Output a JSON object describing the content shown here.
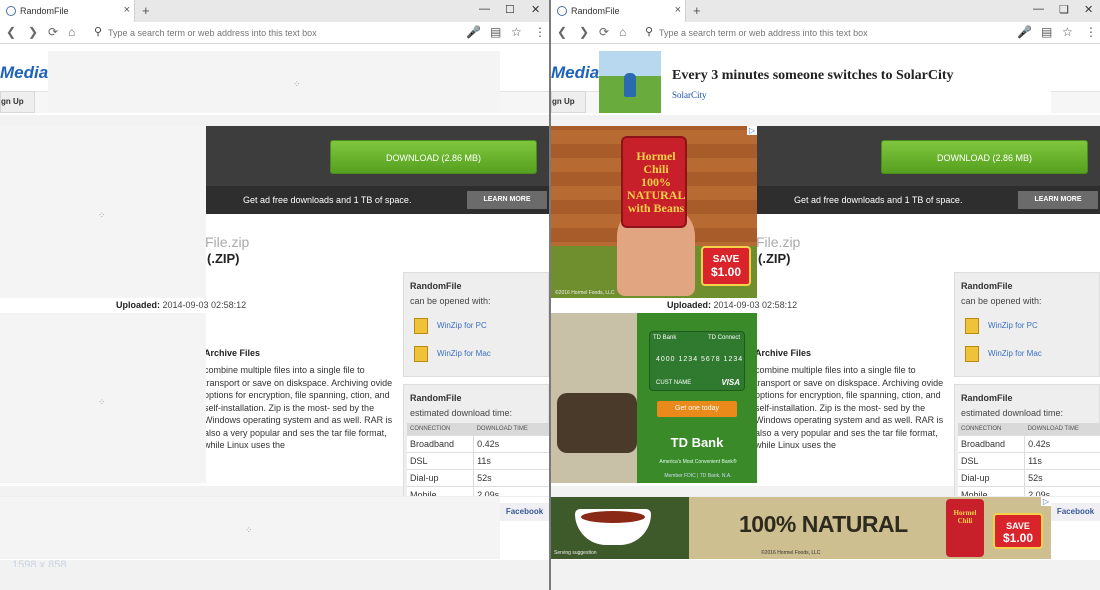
{
  "browser": {
    "tab_title": "RandomFile",
    "new_tab_symbol": "+",
    "tab_close_symbol": "×",
    "address_placeholder": "Type a search term or web address into this text box",
    "icons": [
      "back-icon",
      "forward-icon",
      "reload-icon",
      "home-icon",
      "search-icon",
      "microphone-icon",
      "reader-view-icon",
      "star-icon",
      "menu-icon",
      "minimize-icon",
      "maximize-icon",
      "close-icon"
    ]
  },
  "site": {
    "logo": "Media",
    "signup_label": "gn Up",
    "download_button": "DOWNLOAD (2.86 MB)",
    "promo_text": "Get ad free downloads and 1 TB of space.",
    "learn_more": "LEARN MORE",
    "file_name_suffix": "File.zip",
    "file_type": "(.ZIP)",
    "uploaded_label": "Uploaded:",
    "uploaded_value": "2014-09-03 02:58:12",
    "archive_title": "Archive Files",
    "description": "combine multiple files into a single file to transport or save on diskspace. Archiving ovide options for encryption, file spanning, ction, and self-installation. Zip is the most- sed by the Windows operating system and as well. RAR is also a very popular and ses the tar file format, while Linux uses the",
    "open_box": {
      "title": "RandomFile",
      "subtitle": "can be opened with:",
      "apps": [
        "WinZip for PC",
        "WinZip for Mac"
      ]
    },
    "time_box": {
      "title": "RandomFile",
      "subtitle": "estimated download time:",
      "headers": [
        "CONNECTION",
        "DOWNLOAD TIME"
      ],
      "rows": [
        {
          "connection": "Broadband",
          "time": "0.42s"
        },
        {
          "connection": "DSL",
          "time": "11s"
        },
        {
          "connection": "Dial-up",
          "time": "52s"
        },
        {
          "connection": "Mobile",
          "time": "2.09s"
        }
      ]
    },
    "facebook_tab": "Facebook"
  },
  "left_pane": {
    "spinner_glyph": "⁘",
    "dimensions_label": "1598 x 858"
  },
  "ads": {
    "top": {
      "title": "Every 3 minutes someone switches to SolarCity",
      "subtitle": "SolarCity"
    },
    "chili": {
      "can_text": "Hormel Chili 100% NATURAL with Beans",
      "save_line1": "SAVE",
      "save_line2": "$1.00",
      "copyright": "©2016 Hormel Foods, LLC"
    },
    "td": {
      "card_brand": "TD Bank",
      "card_sub": "TD Connect",
      "card_number": "4000 1234 5678 1234",
      "card_name": "CUST NAME",
      "card_visa": "VISA",
      "cta": "Get one today",
      "logo": "TD Bank",
      "tagline": "America's Most Convenient Bank®",
      "fine": "Member FDIC | TD Bank, N.A."
    },
    "banner": {
      "headline": "100% NATURAL",
      "can_text": "Hormel Chili",
      "save_line1": "SAVE",
      "save_line2": "$1.00",
      "serving": "Serving suggestion",
      "copyright": "©2016 Hormel Foods, LLC"
    },
    "adchoices_symbol": "▷"
  },
  "colors": {
    "accent_green": "#55a01f",
    "link_blue": "#3b6fc2",
    "dark_bar": "#3d3d3d",
    "facebook_blue": "#3b5998"
  }
}
